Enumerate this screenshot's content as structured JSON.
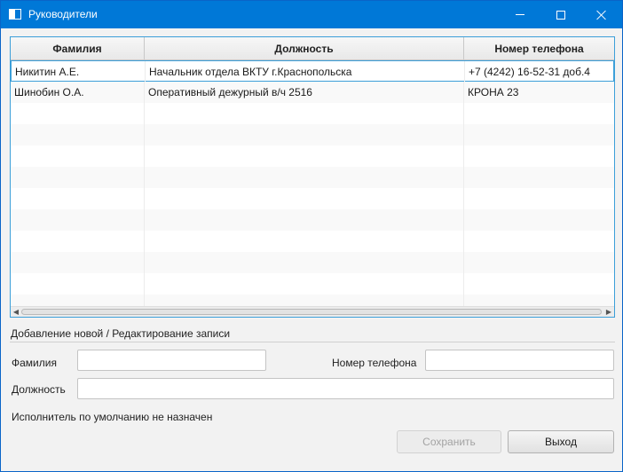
{
  "window": {
    "title": "Руководители"
  },
  "table": {
    "columns": [
      "Фамилия",
      "Должность",
      "Номер телефона"
    ],
    "rows": [
      {
        "surname": "Никитин А.Е.",
        "position": "Начальник отдела ВКТУ г.Краснопольска",
        "phone": "+7 (4242) 16-52-31 доб.4"
      },
      {
        "surname": "Шинобин О.А.",
        "position": "Оперативный дежурный в/ч 2516",
        "phone": "КРОНА 23"
      }
    ],
    "selected_row": 0
  },
  "form": {
    "section_title": "Добавление новой / Редактирование записи",
    "surname_label": "Фамилия",
    "surname_value": "",
    "phone_label": "Номер телефона",
    "phone_value": "",
    "position_label": "Должность",
    "position_value": ""
  },
  "status": {
    "text": "Исполнитель по умолчанию не назначен"
  },
  "buttons": {
    "save_label": "Сохранить",
    "save_enabled": false,
    "exit_label": "Выход"
  },
  "colors": {
    "titlebar": "#0078d7",
    "selection_border": "#3c9fd9"
  }
}
